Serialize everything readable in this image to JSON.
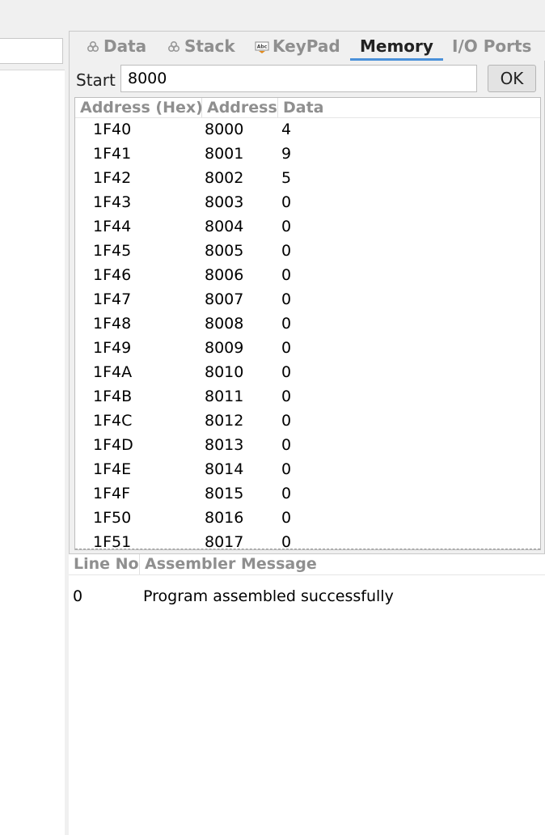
{
  "tabs": [
    {
      "label": "Data",
      "icon": "data-icon",
      "active": false
    },
    {
      "label": "Stack",
      "icon": "stack-icon",
      "active": false
    },
    {
      "label": "KeyPad",
      "icon": "keypad-icon",
      "active": false
    },
    {
      "label": "Memory",
      "icon": "",
      "active": true
    },
    {
      "label": "I/O Ports",
      "icon": "",
      "active": false
    }
  ],
  "memory": {
    "start_label": "Start",
    "start_value": "8000",
    "ok_label": "OK",
    "columns": [
      "Address (Hex)",
      "Address",
      "Data"
    ],
    "rows": [
      [
        "1F40",
        "8000",
        "4"
      ],
      [
        "1F41",
        "8001",
        "9"
      ],
      [
        "1F42",
        "8002",
        "5"
      ],
      [
        "1F43",
        "8003",
        "0"
      ],
      [
        "1F44",
        "8004",
        "0"
      ],
      [
        "1F45",
        "8005",
        "0"
      ],
      [
        "1F46",
        "8006",
        "0"
      ],
      [
        "1F47",
        "8007",
        "0"
      ],
      [
        "1F48",
        "8008",
        "0"
      ],
      [
        "1F49",
        "8009",
        "0"
      ],
      [
        "1F4A",
        "8010",
        "0"
      ],
      [
        "1F4B",
        "8011",
        "0"
      ],
      [
        "1F4C",
        "8012",
        "0"
      ],
      [
        "1F4D",
        "8013",
        "0"
      ],
      [
        "1F4E",
        "8014",
        "0"
      ],
      [
        "1F4F",
        "8015",
        "0"
      ],
      [
        "1F50",
        "8016",
        "0"
      ],
      [
        "1F51",
        "8017",
        "0"
      ]
    ]
  },
  "messages": {
    "columns": [
      "Line No",
      "Assembler Message"
    ],
    "rows": [
      [
        "0",
        "Program assembled successfully"
      ]
    ]
  },
  "colors": {
    "accent": "#4a90d9",
    "header_text": "#8f8f8f",
    "panel_bg": "#f0f0f0"
  }
}
